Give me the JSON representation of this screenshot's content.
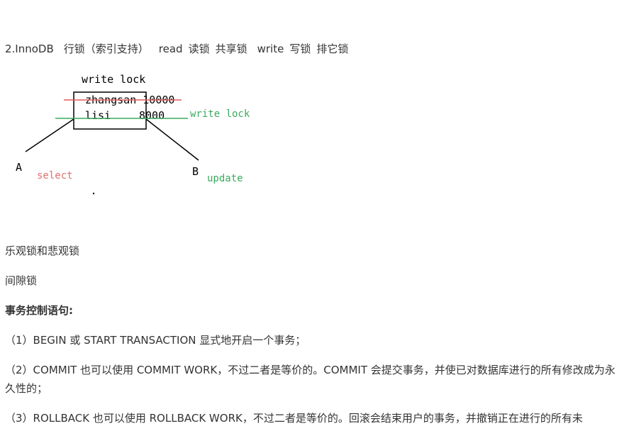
{
  "heading": {
    "title": "2.InnoDB",
    "row_lock": "行锁（索引支持）",
    "read": "read",
    "read_lock": "读锁",
    "shared_lock": "共享锁",
    "write": "write",
    "write_lock": "写锁",
    "exclusive_lock": "排它锁"
  },
  "diagram": {
    "top_label": "write lock",
    "row1": "zhangsan 10000",
    "row2_name": "lisi",
    "row2_value": "8000",
    "side_label": "write lock",
    "client_a": "A",
    "client_b": "B",
    "action_a": "select",
    "action_b": "update",
    "colors": {
      "strike": "#e05a5a",
      "green": "#3aaa5c",
      "select": "#e07070",
      "line": "#000000"
    }
  },
  "sections": {
    "optimistic": "乐观锁和悲观锁",
    "gap_lock": "间隙锁",
    "tx_heading": "事务控制语句:",
    "item1": "（1）BEGIN 或 START TRANSACTION 显式地开启一个事务；",
    "item2": "（2）COMMIT 也可以使用 COMMIT WORK，不过二者是等价的。COMMIT 会提交事务，并使已对数据库进行的所有修改成为永久性的；",
    "item3": "（3）ROLLBACK 也可以使用 ROLLBACK WORK，不过二者是等价的。回滚会结束用户的事务，并撤销正在进行的所有未"
  }
}
